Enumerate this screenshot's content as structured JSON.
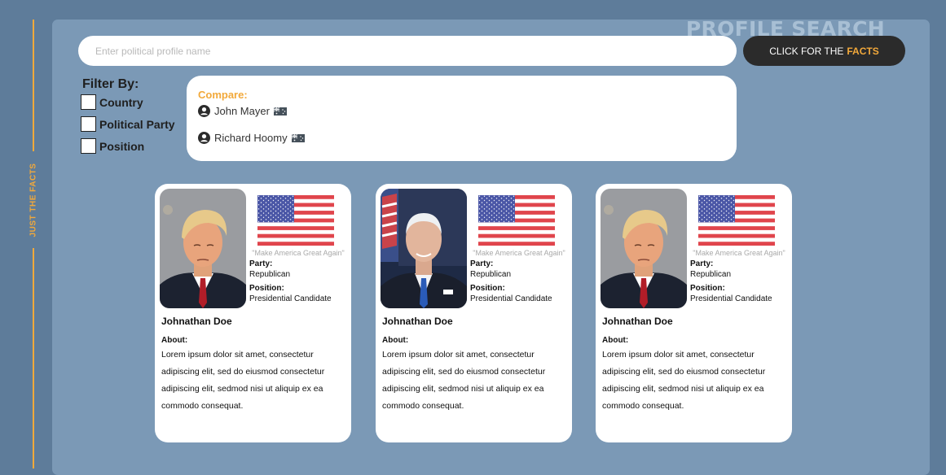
{
  "brand": {
    "side_label": "JUST THE FACTS",
    "accent_color": "#f2a93b"
  },
  "header": {
    "title": "PROFILE SEARCH"
  },
  "search": {
    "placeholder": "Enter political profile name",
    "value": "",
    "button_prefix": "CLICK FOR THE",
    "button_accent": "FACTS"
  },
  "filters": {
    "title": "Filter By:",
    "options": [
      {
        "label": "Country",
        "checked": false
      },
      {
        "label": "Political Party",
        "checked": false
      },
      {
        "label": "Position",
        "checked": false
      }
    ]
  },
  "compare": {
    "title": "Compare:",
    "items": [
      {
        "name": "John Mayer",
        "icon": "user-icon",
        "flag": "australia-flag"
      },
      {
        "name": "Richard Hoomy",
        "icon": "user-icon",
        "flag": "australia-flag"
      }
    ]
  },
  "cards": [
    {
      "photo": "mugshot-photo",
      "flag": "us-flag",
      "slogan": "\"Make America Great Again\"",
      "party_label": "Party:",
      "party": "Republican",
      "position_label": "Position:",
      "position": "Presidential Candidate",
      "name": "Johnathan Doe",
      "about_label": "About:",
      "about": "Lorem ipsum dolor sit amet,  consectetur adipiscing elit, sed do eiusmod consectetur adipiscing elit, sedmod nisi ut aliquip ex ea commodo consequat."
    },
    {
      "photo": "portrait-photo",
      "flag": "us-flag",
      "slogan": "\"Make America Great Again\"",
      "party_label": "Party:",
      "party": "Republican",
      "position_label": "Position:",
      "position": "Presidential Candidate",
      "name": "Johnathan Doe",
      "about_label": "About:",
      "about": "Lorem ipsum dolor sit amet,  consectetur adipiscing elit, sed do eiusmod consectetur adipiscing elit, sedmod nisi ut aliquip ex ea commodo consequat."
    },
    {
      "photo": "mugshot-photo",
      "flag": "us-flag",
      "slogan": "\"Make America Great Again\"",
      "party_label": "Party:",
      "party": "Republican",
      "position_label": "Position:",
      "position": "Presidential Candidate",
      "name": "Johnathan Doe",
      "about_label": "About:",
      "about": "Lorem ipsum dolor sit amet,  consectetur adipiscing elit, sed do eiusmod consectetur adipiscing elit, sedmod nisi ut aliquip ex ea commodo consequat."
    }
  ]
}
